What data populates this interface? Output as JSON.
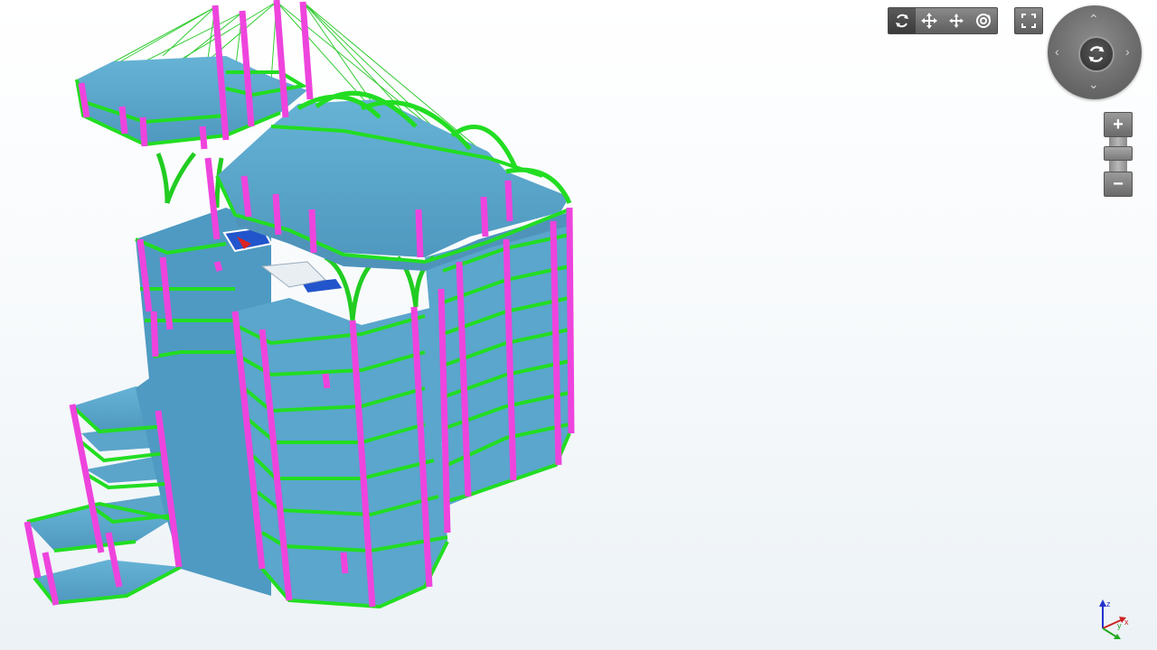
{
  "viewer": {
    "toolbar": {
      "tools": [
        {
          "name": "orbit",
          "icon": "orbit-icon",
          "active": true
        },
        {
          "name": "pan",
          "icon": "pan-icon",
          "active": false
        },
        {
          "name": "pan-alt",
          "icon": "pan-alt-icon",
          "active": false
        },
        {
          "name": "look-around",
          "icon": "look-around-icon",
          "active": false
        }
      ],
      "fullscreen_icon": "fullscreen-icon"
    },
    "navigation_wheel": {
      "arrows": [
        "up",
        "down",
        "left",
        "right"
      ],
      "center_icon": "orbit-icon"
    },
    "zoom": {
      "plus_label": "+",
      "minus_label": "−"
    },
    "axis_triad": {
      "axes": [
        "z",
        "y",
        "x"
      ],
      "colors": {
        "x": "#cc2222",
        "y": "#22aa22",
        "z": "#2233cc"
      }
    },
    "model_colors": {
      "slab": "#5aa6cc",
      "beam": "#22dd22",
      "column": "#ee44dd",
      "cable": "#33cc33"
    }
  }
}
